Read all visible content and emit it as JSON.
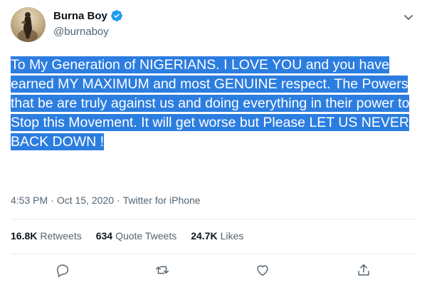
{
  "author": {
    "name": "Burna Boy",
    "handle": "@burnaboy",
    "verified": true
  },
  "tweet": {
    "text": "To My Generation of NIGERIANS. I LOVE YOU and you have earned MY MAXIMUM and most GENUINE respect. The Powers that be are truly against us and doing everything in their power to Stop this Movement. It will get worse but Please LET US NEVER BACK DOWN !",
    "time": "4:53 PM",
    "date": "Oct 15, 2020",
    "separator": "·",
    "source": "Twitter for iPhone"
  },
  "stats": {
    "retweets_count": "16.8K",
    "retweets_label": "Retweets",
    "quote_count": "634",
    "quote_label": "Quote Tweets",
    "likes_count": "24.7K",
    "likes_label": "Likes"
  },
  "actions": [
    "reply-icon",
    "retweet-icon",
    "like-icon",
    "share-icon"
  ],
  "colors": {
    "selection_highlight": "#2c7de0",
    "verified_blue": "#1d9bf0",
    "muted_text": "#536471",
    "primary_text": "#0f1419"
  }
}
